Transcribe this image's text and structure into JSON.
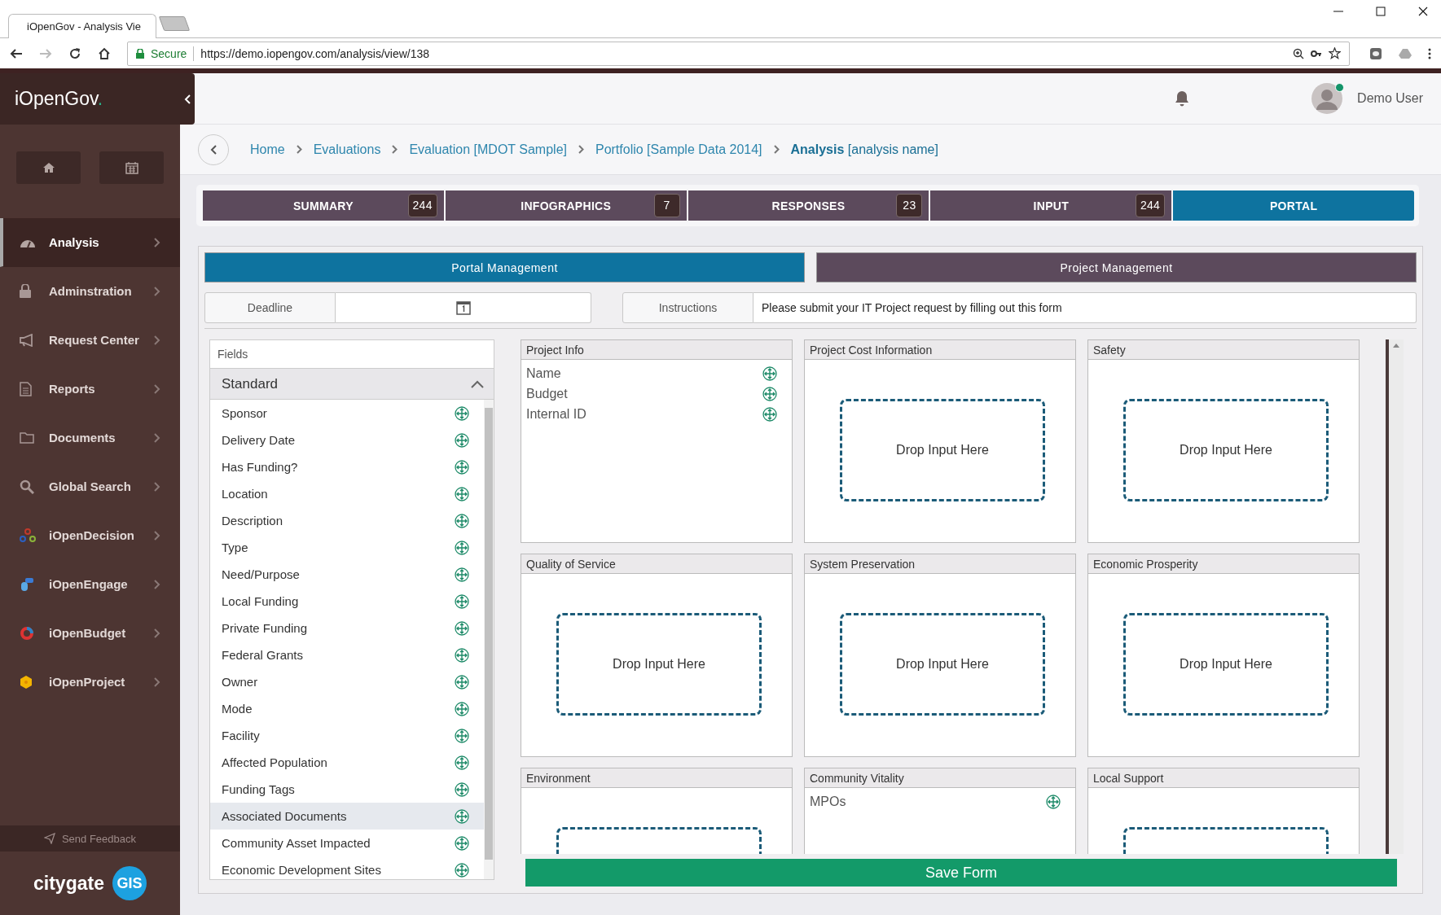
{
  "browser": {
    "tab_title": "iOpenGov - Analysis Vie",
    "secure_label": "Secure",
    "url": "https://demo.iopengov.com/analysis/view/138"
  },
  "sidebar": {
    "logo": "iOpenGov",
    "logo_dot": ".",
    "items": [
      {
        "label": "Analysis",
        "selected": true
      },
      {
        "label": "Adminstration",
        "selected": false
      },
      {
        "label": "Request Center",
        "selected": false
      },
      {
        "label": "Reports",
        "selected": false
      },
      {
        "label": "Documents",
        "selected": false
      },
      {
        "label": "Global Search",
        "selected": false
      },
      {
        "label": "iOpenDecision",
        "selected": false
      },
      {
        "label": "iOpenEngage",
        "selected": false
      },
      {
        "label": "iOpenBudget",
        "selected": false
      },
      {
        "label": "iOpenProject",
        "selected": false
      }
    ],
    "feedback": "Send Feedback",
    "brand": "citygate",
    "brand_badge": "GIS"
  },
  "header": {
    "user": "Demo User",
    "online": true
  },
  "breadcrumb": [
    {
      "label": "Home",
      "current": false
    },
    {
      "label": "Evaluations",
      "current": false
    },
    {
      "label": "Evaluation [MDOT Sample]",
      "current": false
    },
    {
      "label": "Portfolio [Sample Data 2014]",
      "current": false
    },
    {
      "label": "**Analysis** [analysis name]",
      "current": true
    }
  ],
  "tabs": [
    {
      "label": "SUMMARY",
      "count": "244",
      "selected": false
    },
    {
      "label": "INFOGRAPHICS",
      "count": "7",
      "selected": false
    },
    {
      "label": "RESPONSES",
      "count": "23",
      "selected": false
    },
    {
      "label": "INPUT",
      "count": "244",
      "selected": false
    },
    {
      "label": "PORTAL",
      "selected": true
    }
  ],
  "subtabs": [
    {
      "label": "Portal Management",
      "selected": true
    },
    {
      "label": "Project Management",
      "selected": false
    }
  ],
  "deadline": {
    "label": "Deadline"
  },
  "instructions": {
    "label": "Instructions",
    "value": "Please submit your IT Project request by filling out this form"
  },
  "fields": {
    "title": "Fields",
    "group": "Standard",
    "expanded": true,
    "items": [
      {
        "label": "Sponsor",
        "selected": false
      },
      {
        "label": "Delivery Date",
        "selected": false
      },
      {
        "label": "Has Funding?",
        "selected": false
      },
      {
        "label": "Location",
        "selected": false
      },
      {
        "label": "Description",
        "selected": false
      },
      {
        "label": "Type",
        "selected": false
      },
      {
        "label": "Need/Purpose",
        "selected": false
      },
      {
        "label": "Local Funding",
        "selected": false
      },
      {
        "label": "Private Funding",
        "selected": false
      },
      {
        "label": "Federal Grants",
        "selected": false
      },
      {
        "label": "Owner",
        "selected": false
      },
      {
        "label": "Mode",
        "selected": false
      },
      {
        "label": "Facility",
        "selected": false
      },
      {
        "label": "Affected Population",
        "selected": false
      },
      {
        "label": "Funding Tags",
        "selected": false
      },
      {
        "label": "Associated Documents",
        "selected": true
      },
      {
        "label": "Community Asset Impacted",
        "selected": false
      },
      {
        "label": "Economic Development Sites",
        "selected": false
      }
    ]
  },
  "sections": [
    {
      "title": "Project Info",
      "kind": "list",
      "items": [
        "Name",
        "Budget",
        "Internal ID"
      ]
    },
    {
      "title": "Project Cost Information",
      "kind": "drop",
      "label": "Drop Input Here"
    },
    {
      "title": "Safety",
      "kind": "drop",
      "label": "Drop Input Here"
    },
    {
      "title": "Quality of Service",
      "kind": "drop",
      "label": "Drop Input Here"
    },
    {
      "title": "System Preservation",
      "kind": "drop",
      "label": "Drop Input Here"
    },
    {
      "title": "Economic Prosperity",
      "kind": "drop",
      "label": "Drop Input Here"
    },
    {
      "title": "Environment",
      "kind": "drop"
    },
    {
      "title": "Community Vitality",
      "kind": "list",
      "items": [
        "MPOs"
      ]
    },
    {
      "title": "Local Support",
      "kind": "drop"
    }
  ],
  "save_button": "Save Form"
}
